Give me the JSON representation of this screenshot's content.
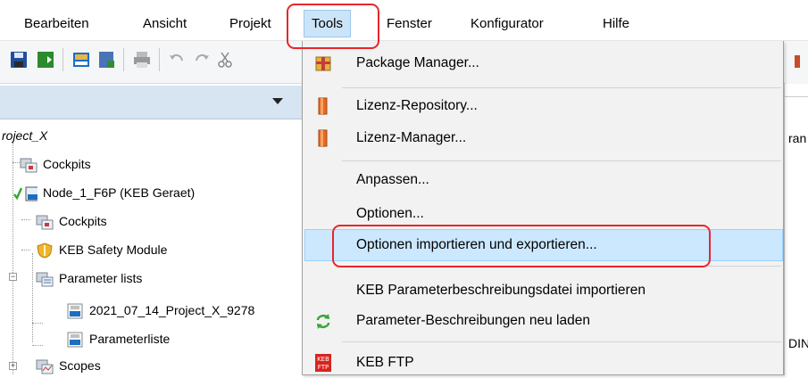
{
  "menubar": {
    "items": [
      "Bearbeiten",
      "Ansicht",
      "Projekt",
      "Tools",
      "Fenster",
      "Konfigurator",
      "Hilfe"
    ],
    "active": "Tools"
  },
  "tree": {
    "root": "roject_X",
    "items": [
      {
        "label": "Cockpits",
        "icon": "cockpit-icon"
      },
      {
        "label": "Node_1_F6P (KEB Geraet)",
        "icon": "keb-node-icon"
      },
      {
        "label": "Cockpits",
        "icon": "cockpit-icon"
      },
      {
        "label": "KEB Safety Module",
        "icon": "shield-icon"
      },
      {
        "label": "Parameter lists",
        "icon": "parameter-list-icon"
      },
      {
        "label": "2021_07_14_Project_X_9278",
        "icon": "keb-parameter-icon"
      },
      {
        "label": "Parameterliste",
        "icon": "keb-parameter-icon"
      },
      {
        "label": "Scopes",
        "icon": "scope-icon"
      }
    ]
  },
  "tools_menu": {
    "items": [
      {
        "label": "Package Manager...",
        "icon": "package-icon"
      },
      {
        "label": "Lizenz-Repository...",
        "icon": "license-icon"
      },
      {
        "label": "Lizenz-Manager...",
        "icon": "license-icon"
      },
      {
        "label": "Anpassen...",
        "icon": ""
      },
      {
        "label": "Optionen...",
        "icon": ""
      },
      {
        "label": "Optionen importieren und exportieren...",
        "icon": ""
      },
      {
        "label": "KEB Parameterbeschreibungsdatei importieren",
        "icon": ""
      },
      {
        "label": "Parameter-Beschreibungen neu laden",
        "icon": "refresh-icon"
      },
      {
        "label": "KEB FTP",
        "icon": "keb-ftp-icon"
      }
    ],
    "highlighted": "Optionen importieren und exportieren..."
  },
  "right_area": {
    "text_1": "ran",
    "text_2": "DIN"
  },
  "colors": {
    "highlight_red": "#e8262a",
    "hover_blue": "#cce8ff",
    "panel_header": "#d7e4f2"
  }
}
